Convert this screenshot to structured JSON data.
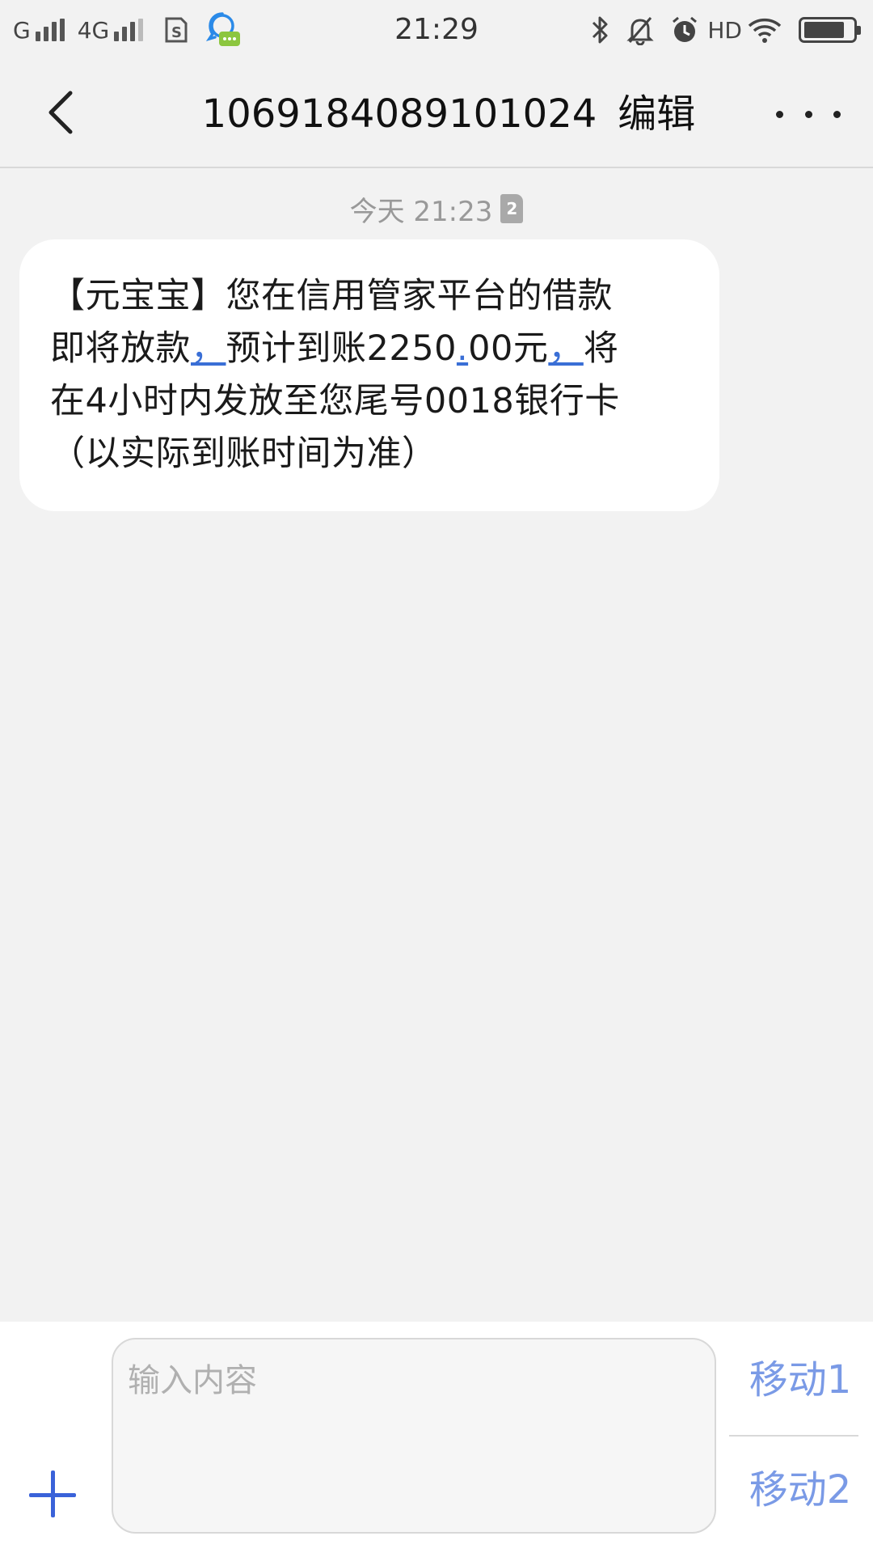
{
  "status_bar": {
    "carrier1": "G",
    "carrier2": "4G",
    "time": "21:29",
    "hd_label": "HD",
    "icons": [
      "signal-icon",
      "sim-card-icon",
      "chat-assistant-icon",
      "bluetooth-icon",
      "mute-icon",
      "alarm-icon",
      "wifi-icon",
      "battery-icon"
    ],
    "battery_level": 0.85
  },
  "header": {
    "title": "1069184089101024",
    "edit_label": "编辑",
    "back_icon": "chevron-left-icon",
    "more_icon": "more-icon"
  },
  "conversation": {
    "timestamp": "今天 21:23",
    "sim_badge": "2",
    "message": {
      "line1": "【元宝宝】您在信用管家平台的借款",
      "line2_a": "即将放款",
      "line2_b": "，",
      "line2_c": "预计到账2250",
      "line2_d": ".",
      "line2_e": "00元",
      "line2_f": "，",
      "line2_g": "将",
      "line3": "在4小时内发放至您尾号0018银行卡",
      "line4": "（以实际到账时间为准）"
    }
  },
  "composer": {
    "placeholder": "输入内容",
    "send_sim1": "移动1",
    "send_sim2": "移动2",
    "accent": "#3a62d9"
  }
}
